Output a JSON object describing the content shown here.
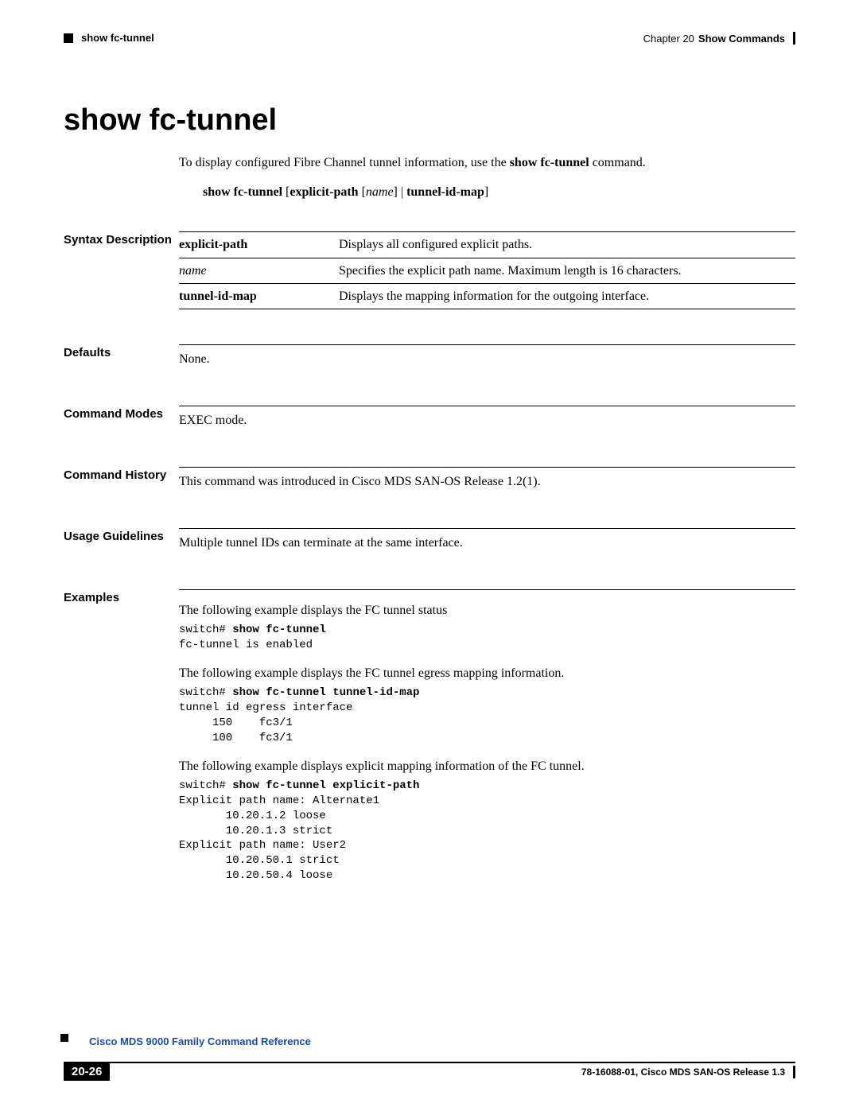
{
  "header": {
    "left_marker": "■",
    "running_head_left": "show fc-tunnel",
    "chapter_label": "Chapter 20",
    "chapter_title": "Show Commands"
  },
  "title": "show fc-tunnel",
  "intro_text": "To display configured Fibre Channel tunnel information, use the ",
  "intro_cmd": "show fc-tunnel",
  "intro_tail": " command.",
  "syntax_line_prefix": "show fc-tunnel",
  "syntax_line_bracket1": " [",
  "syntax_line_kw1": "explicit-path",
  "syntax_line_space": " [",
  "syntax_line_italic": "name",
  "syntax_line_bracket2": "] | ",
  "syntax_line_kw2": "tunnel-id-map",
  "syntax_line_end": "]",
  "sections": {
    "syntax_desc_label": "Syntax Description",
    "syntax_rows": [
      {
        "term_bold": "explicit-path",
        "term_italic": "",
        "desc": "Displays all configured explicit paths."
      },
      {
        "term_bold": "",
        "term_italic": "name",
        "desc": "Specifies the explicit path name. Maximum length is 16 characters."
      },
      {
        "term_bold": "tunnel-id-map",
        "term_italic": "",
        "desc": "Displays the mapping information for the outgoing interface."
      }
    ],
    "defaults_label": "Defaults",
    "defaults_text": "None.",
    "modes_label": "Command Modes",
    "modes_text": "EXEC mode.",
    "history_label": "Command History",
    "history_text": "This command was introduced in Cisco MDS SAN-OS Release 1.2(1).",
    "usage_label": "Usage Guidelines",
    "usage_text": "Multiple tunnel IDs can terminate at the same interface.",
    "examples_label": "Examples",
    "examples_intro1": "The following example displays the FC tunnel status",
    "examples_block1_prompt": "switch# ",
    "examples_block1_cmd": "show fc-tunnel",
    "examples_block1_out": "fc-tunnel is enabled",
    "examples_intro2": "The following example displays the FC tunnel egress mapping information.",
    "examples_block2_prompt": "switch# ",
    "examples_block2_cmd": "show fc-tunnel tunnel-id-map",
    "examples_block2_out": "tunnel id egress interface\n     150    fc3/1\n     100    fc3/1",
    "examples_intro3": "The following example displays explicit mapping information of the FC tunnel.",
    "examples_block3_prompt": "switch# ",
    "examples_block3_cmd": "show fc-tunnel explicit-path",
    "examples_block3_out": "Explicit path name: Alternate1\n       10.20.1.2 loose\n       10.20.1.3 strict\nExplicit path name: User2\n       10.20.50.1 strict\n       10.20.50.4 loose"
  },
  "footer": {
    "page_num": "20-26",
    "book_title": "Cisco MDS 9000 Family Command Reference",
    "doc_id": "78-16088-01, Cisco MDS SAN-OS Release 1.3"
  }
}
